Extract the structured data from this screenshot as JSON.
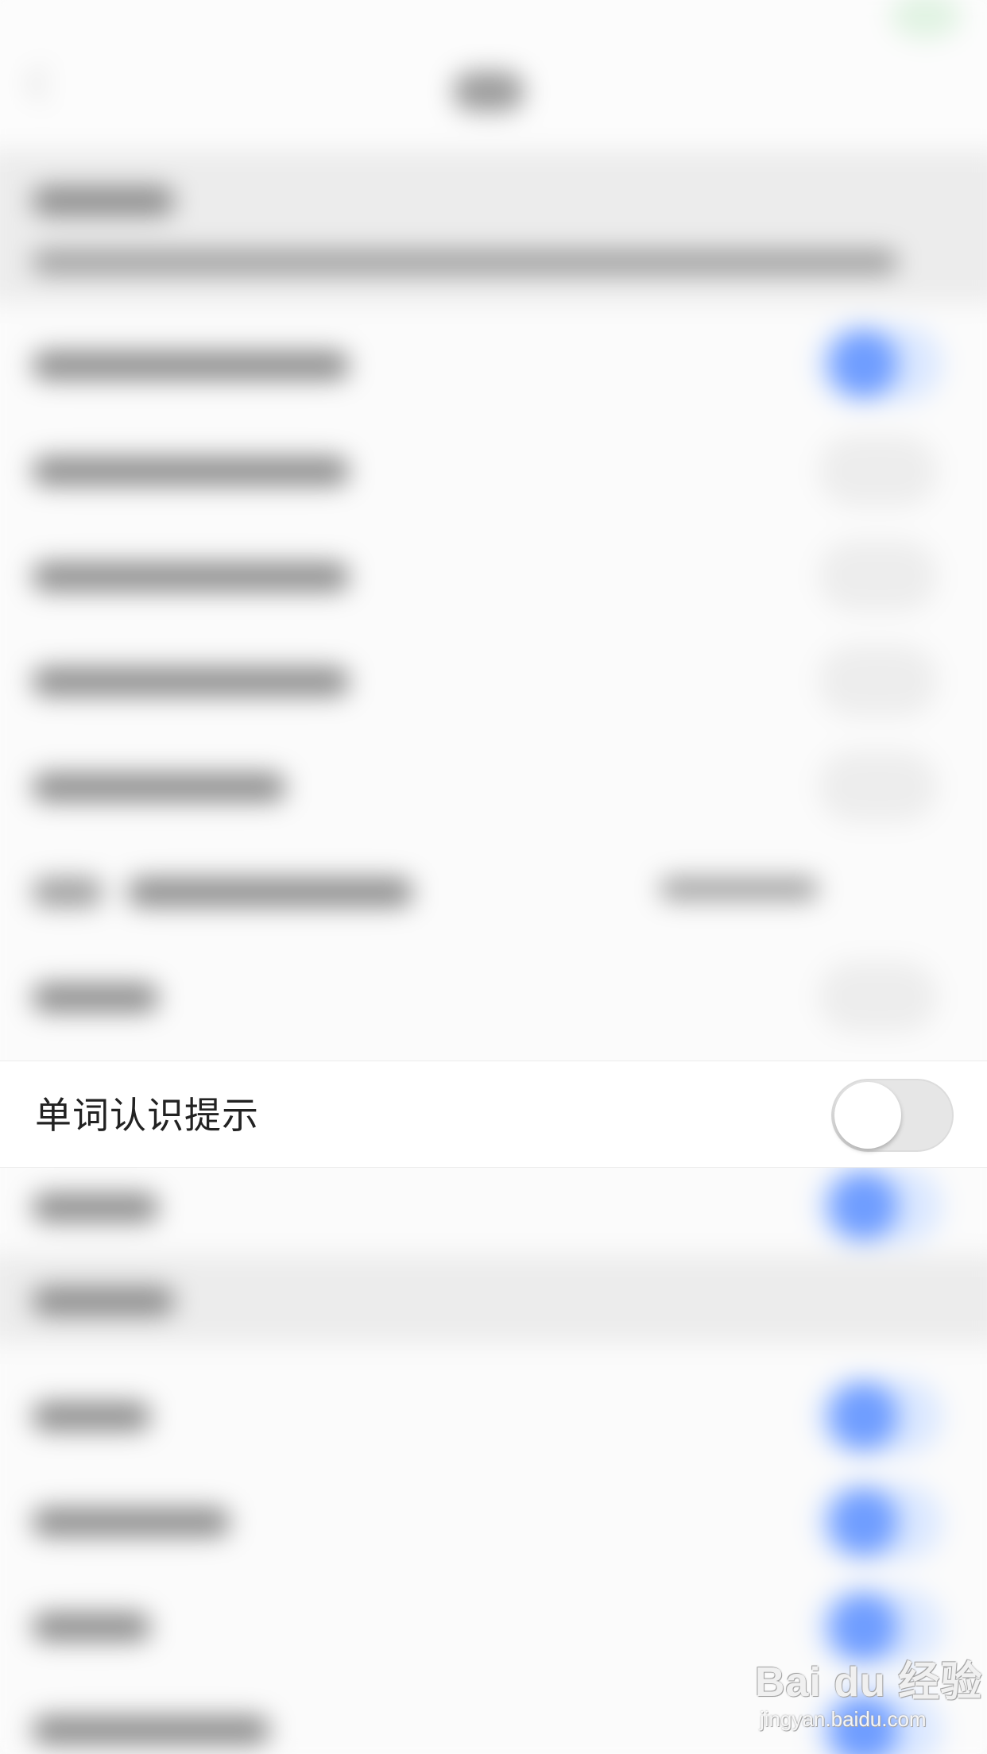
{
  "setting_row": {
    "label": "单词认识提示",
    "toggle_state": "off"
  },
  "watermark": {
    "logo_text": "Bai du 经验",
    "url": "jingyan.baidu.com"
  },
  "colors": {
    "accent": "#6f9dff",
    "toggle_off_track": "#e6e6e6",
    "toggle_knob": "#ffffff",
    "text": "#222222",
    "background": "#f7f7f7"
  }
}
